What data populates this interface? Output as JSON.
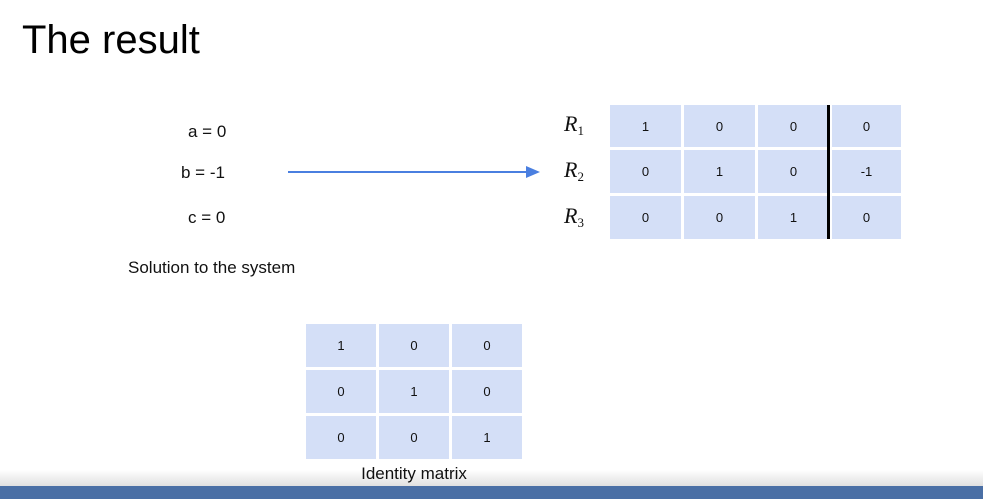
{
  "slide": {
    "title": "The result"
  },
  "solution": {
    "equations": [
      "a  =  0",
      "b =  -1",
      "c  =  0"
    ],
    "label": "Solution to the system"
  },
  "augmented_matrix": {
    "row_labels": [
      {
        "letter": "R",
        "index": "1"
      },
      {
        "letter": "R",
        "index": "2"
      },
      {
        "letter": "R",
        "index": "3"
      }
    ],
    "rows": [
      [
        "1",
        "0",
        "0",
        "0"
      ],
      [
        "0",
        "1",
        "0",
        "-1"
      ],
      [
        "0",
        "0",
        "1",
        "0"
      ]
    ],
    "cell_color": "#d4dff7"
  },
  "identity_matrix": {
    "rows": [
      [
        "1",
        "0",
        "0"
      ],
      [
        "0",
        "1",
        "0"
      ],
      [
        "0",
        "0",
        "1"
      ]
    ],
    "label": "Identity matrix"
  },
  "colors": {
    "arrow": "#4a7fe0",
    "bottom_bar": "#4a6fa5"
  }
}
